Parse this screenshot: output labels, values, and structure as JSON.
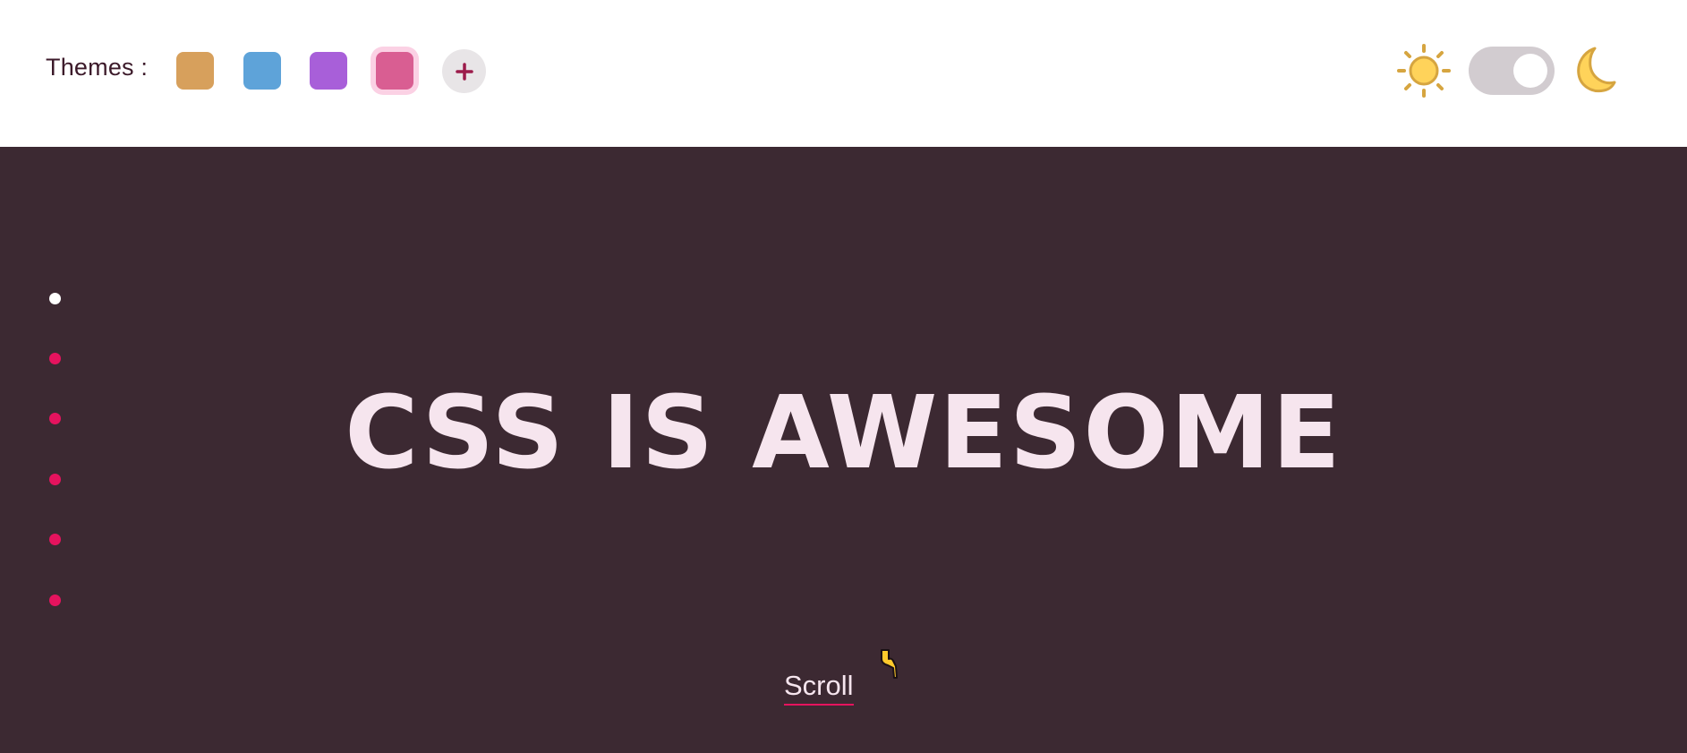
{
  "header": {
    "themes_label": "Themes :",
    "swatches": [
      {
        "name": "orange",
        "color": "#d7a05c",
        "selected": false
      },
      {
        "name": "blue",
        "color": "#5ea3d9",
        "selected": false
      },
      {
        "name": "purple",
        "color": "#a85fd9",
        "selected": false
      },
      {
        "name": "pink",
        "color": "#d95e92",
        "selected": true
      }
    ],
    "add_theme_icon": "plus-icon",
    "theme_toggle": {
      "state": "dark",
      "left_icon": "sun-icon",
      "right_icon": "moon-icon"
    }
  },
  "side_nav": {
    "dots": 6,
    "active_index": 0
  },
  "hero": {
    "title": "CSS IS AWESOME"
  },
  "scroll": {
    "label": "Scroll",
    "cursor_icon": "pointing-hand-icon"
  },
  "colors": {
    "background": "#3c2932",
    "header_background": "#ffffff",
    "accent": "#e5135e",
    "text_light": "#f6e5ee"
  }
}
